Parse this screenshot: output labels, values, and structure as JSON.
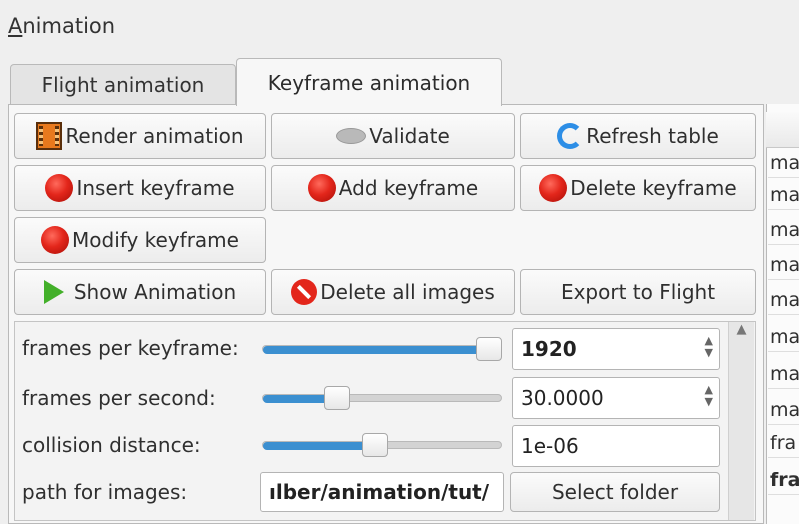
{
  "window": {
    "title_mnemonic": "A",
    "title_rest": "nimation"
  },
  "tabs": [
    {
      "label": "Flight animation",
      "active": false
    },
    {
      "label": "Keyframe animation",
      "active": true
    }
  ],
  "buttons": {
    "render": "Render animation",
    "validate": "Validate",
    "refresh": "Refresh table",
    "insert": "Insert keyframe",
    "add": "Add keyframe",
    "delete": "Delete keyframe",
    "modify": "Modify keyframe",
    "show": "Show Animation",
    "delete_images": "Delete all images",
    "export": "Export to Flight",
    "select_folder": "Select folder"
  },
  "settings": {
    "frames_per_keyframe": {
      "label": "frames per keyframe:",
      "value": "1920",
      "slider_fraction": 1.0
    },
    "frames_per_second": {
      "label": "frames per second:",
      "value": "30.0000",
      "slider_fraction": 0.3
    },
    "collision_distance": {
      "label": "collision distance:",
      "value": "1e-06",
      "slider_fraction": 0.46
    },
    "path_for_images": {
      "label": "path for images:",
      "value": "ılber/animation/tut/"
    }
  },
  "table_cells": [
    "ma",
    "ma",
    "ma",
    "ma",
    "ma",
    "ma",
    "ma",
    "ma",
    "fra",
    "fra"
  ],
  "colors": {
    "slider_fill": "#3b8fd0",
    "ball_red": "#e3261b",
    "play_green": "#43b02a",
    "refresh_blue": "#2d8ee6"
  }
}
